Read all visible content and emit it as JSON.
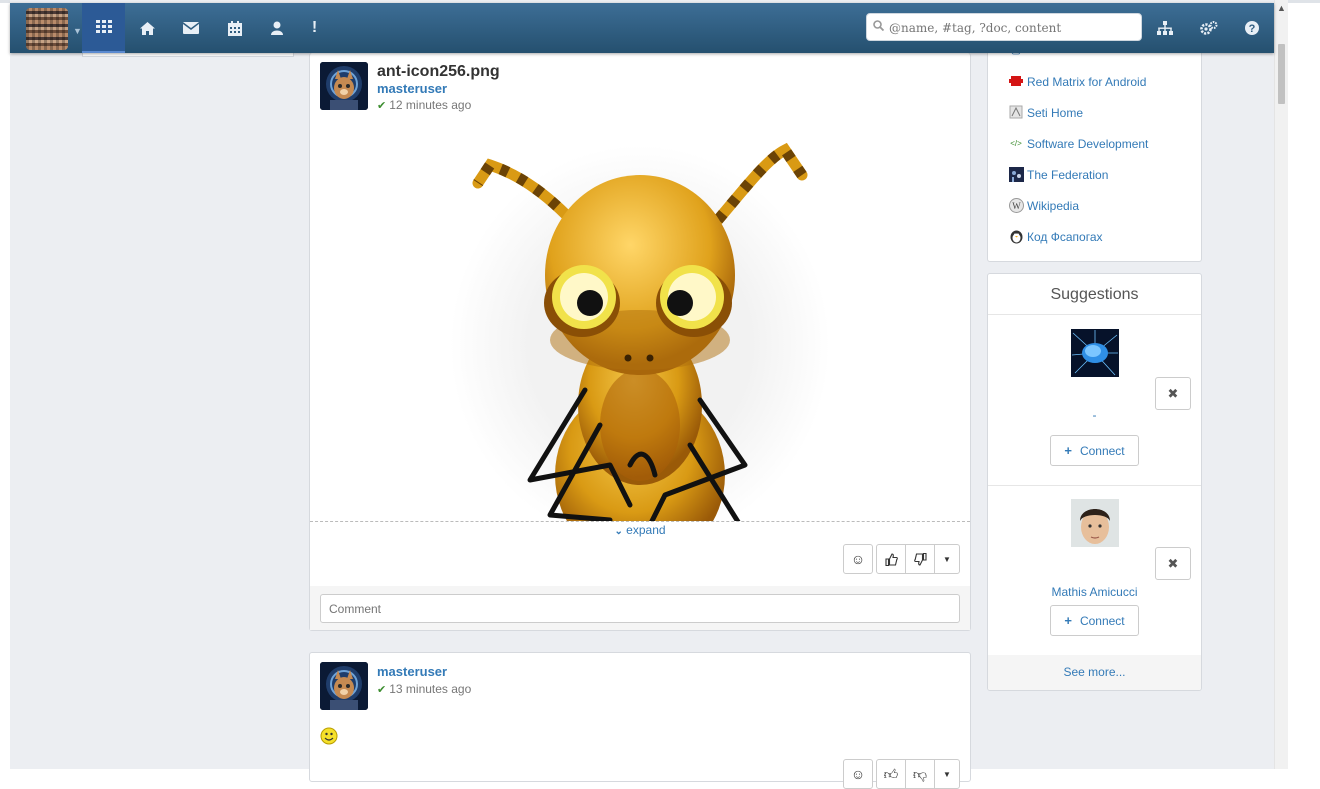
{
  "navbar": {
    "icons": [
      "grid-icon",
      "home-icon",
      "mail-icon",
      "calendar-icon",
      "user-icon",
      "notice-icon"
    ],
    "search_placeholder": "@name, #tag, ?doc, content",
    "right_icons": [
      "sitemap-icon",
      "apps-icon",
      "help-icon"
    ]
  },
  "posts": [
    {
      "title": "ant-icon256.png",
      "author": "masteruser",
      "time": "12 minutes ago",
      "expand_label": "expand",
      "comment_placeholder": "Comment"
    },
    {
      "title": "",
      "author": "masteruser",
      "time": "13 minutes ago"
    }
  ],
  "groups": [
    {
      "label": "Red Matrix for Android",
      "icon": "red-matrix-icon"
    },
    {
      "label": "Seti Home",
      "icon": "seti-icon"
    },
    {
      "label": "Software Development",
      "icon": "code-icon"
    },
    {
      "label": "The Federation",
      "icon": "federation-icon"
    },
    {
      "label": "Wikipedia",
      "icon": "wikipedia-icon"
    },
    {
      "label": "Код Фсапогах",
      "icon": "penguin-icon"
    }
  ],
  "suggestions": {
    "title": "Suggestions",
    "items": [
      {
        "name": "-",
        "connect_label": "Connect"
      },
      {
        "name": "Mathis Amicucci",
        "connect_label": "Connect"
      }
    ],
    "see_more": "See more..."
  },
  "colors": {
    "navbar_top": "#3d6e96",
    "navbar_bottom": "#25506f",
    "link": "#337ab7",
    "page_bg": "#eceef2"
  }
}
